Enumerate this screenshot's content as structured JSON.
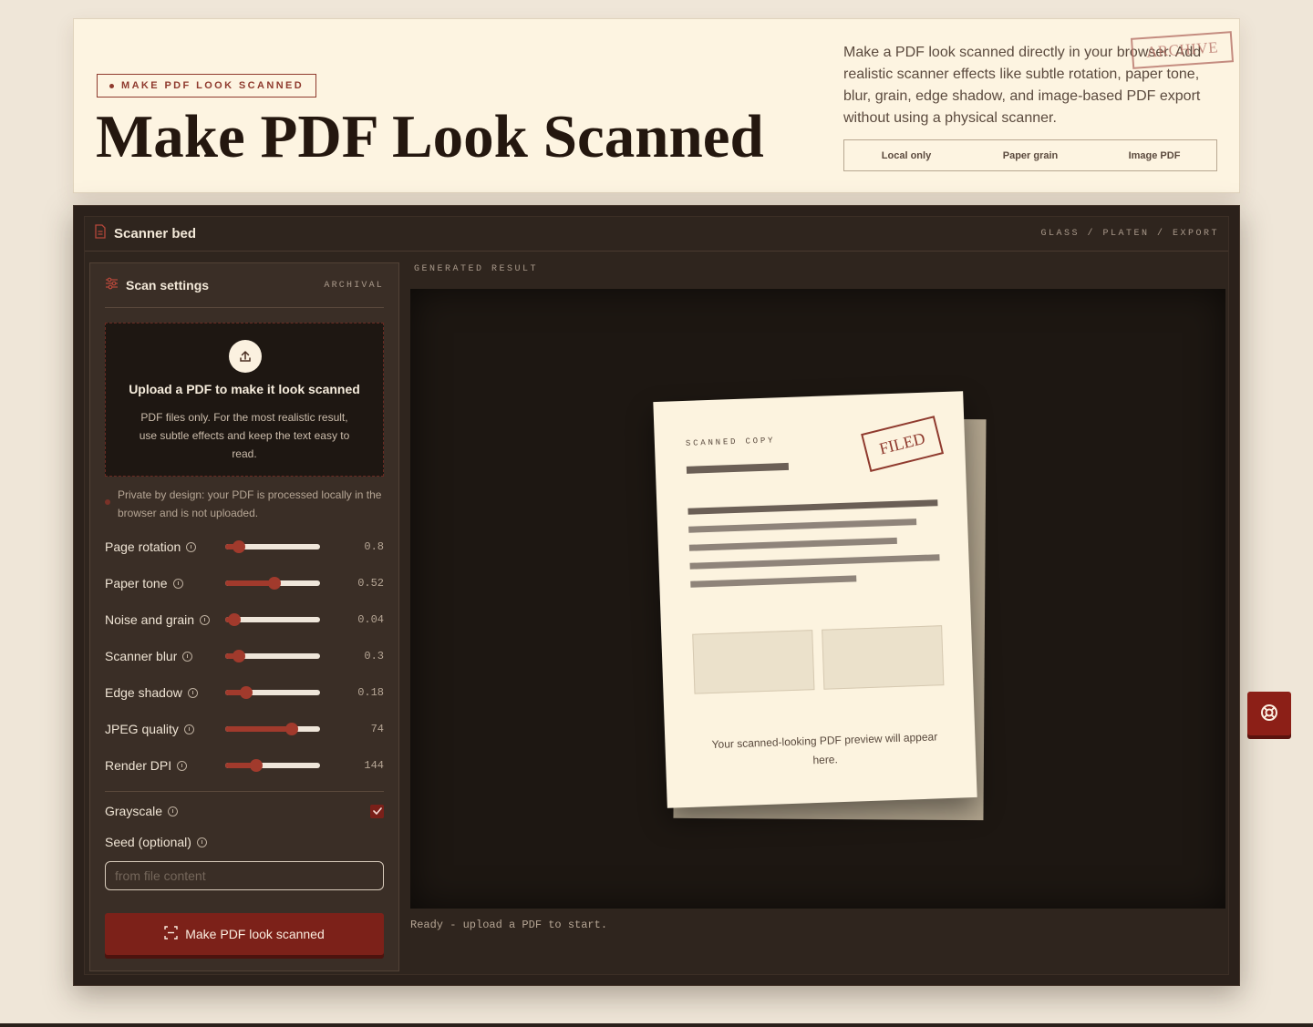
{
  "hero": {
    "eyebrow": "MAKE PDF LOOK SCANNED",
    "title": "Make PDF Look Scanned",
    "description": "Make a PDF look scanned directly in your browser. Add realistic scanner effects like subtle rotation, paper tone, blur, grain, edge shadow, and image-based PDF export without using a physical scanner.",
    "stamp": "ARCHIVE",
    "pills": [
      "Local only",
      "Paper grain",
      "Image PDF"
    ]
  },
  "bed": {
    "title": "Scanner bed",
    "crumbs": "GLASS / PLATEN / EXPORT"
  },
  "settings": {
    "title": "Scan settings",
    "badge": "ARCHIVAL",
    "upload_title": "Upload a PDF to make it look scanned",
    "upload_desc": "PDF files only. For the most realistic result, use subtle effects and keep the text easy to read.",
    "privacy": "Private by design: your PDF is processed locally in the browser and is not uploaded.",
    "sliders": [
      {
        "label": "Page rotation",
        "value": "0.8",
        "fraction": 0.14
      },
      {
        "label": "Paper tone",
        "value": "0.52",
        "fraction": 0.52
      },
      {
        "label": "Noise and grain",
        "value": "0.04",
        "fraction": 0.1
      },
      {
        "label": "Scanner blur",
        "value": "0.3",
        "fraction": 0.14
      },
      {
        "label": "Edge shadow",
        "value": "0.18",
        "fraction": 0.22
      },
      {
        "label": "JPEG quality",
        "value": "74",
        "fraction": 0.7
      },
      {
        "label": "Render DPI",
        "value": "144",
        "fraction": 0.33
      }
    ],
    "grayscale_label": "Grayscale",
    "grayscale_checked": true,
    "seed_label": "Seed (optional)",
    "seed_placeholder": "from file content",
    "seed_value": "",
    "submit_label": "Make PDF look scanned"
  },
  "result": {
    "label": "GENERATED RESULT",
    "paper_kicker": "SCANNED COPY",
    "paper_stamp": "FILED",
    "paper_caption": "Your scanned-looking PDF preview will appear here.",
    "status": "Ready - upload a PDF to start."
  },
  "colors": {
    "accent": "#8f3a2e",
    "button": "#7c2119",
    "slider": "#a13a2c",
    "panel": "#2b211b",
    "paper": "#fcf3df"
  }
}
